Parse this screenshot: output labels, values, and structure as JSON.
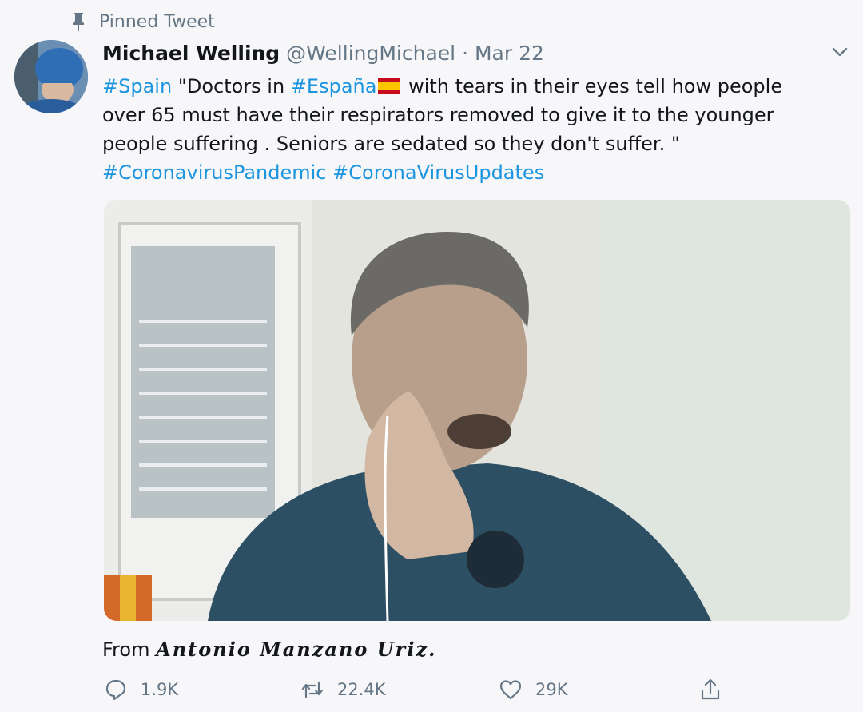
{
  "pinned": {
    "label": "Pinned Tweet",
    "icon": "pin-icon"
  },
  "author": {
    "name": "Michael Welling",
    "handle": "@WellingMichael",
    "separator": "·",
    "date": "Mar 22"
  },
  "tweet": {
    "hashtag_spain": "#Spain",
    "part1": " \"Doctors in ",
    "hashtag_espana": "#España",
    "part2": " with tears in their eyes tell how people over 65 must have their respirators removed to give it to the younger people suffering . Seniors are sedated so they don't suffer. \"",
    "hashtag_pandemic": "#CoronavirusPandemic",
    "hashtag_updates": "#CoronaVirusUpdates"
  },
  "from_line": {
    "prefix": "From ",
    "signature": "Antonio Manzano Uriz."
  },
  "actions": {
    "replies": "1.9K",
    "retweets": "22.4K",
    "likes": "29K"
  },
  "colors": {
    "accent": "#1b95e0",
    "muted": "#657786",
    "background": "#f7f7f9"
  }
}
